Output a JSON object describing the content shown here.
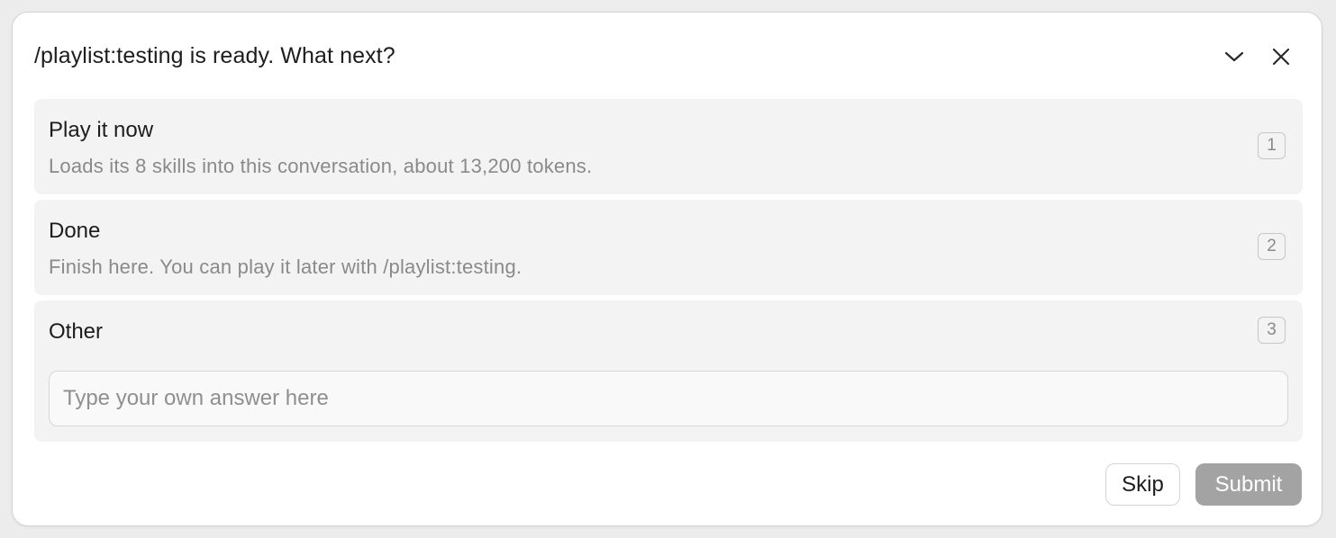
{
  "dialog": {
    "title": "/playlist:testing is ready. What next?",
    "collapse_icon": "chevron-down-icon",
    "close_icon": "close-icon"
  },
  "options": [
    {
      "title": "Play it now",
      "description": "Loads its 8 skills into this conversation, about 13,200 tokens.",
      "shortcut": "1"
    },
    {
      "title": "Done",
      "description": "Finish here. You can play it later with /playlist:testing.",
      "shortcut": "2"
    },
    {
      "title": "Other",
      "shortcut": "3",
      "input_placeholder": "Type your own answer here",
      "input_value": ""
    }
  ],
  "actions": {
    "skip_label": "Skip",
    "submit_label": "Submit"
  },
  "colors": {
    "option_background": "#f3f3f3",
    "submit_disabled": "#a3a3a3",
    "muted_text": "#8a8a8a"
  }
}
